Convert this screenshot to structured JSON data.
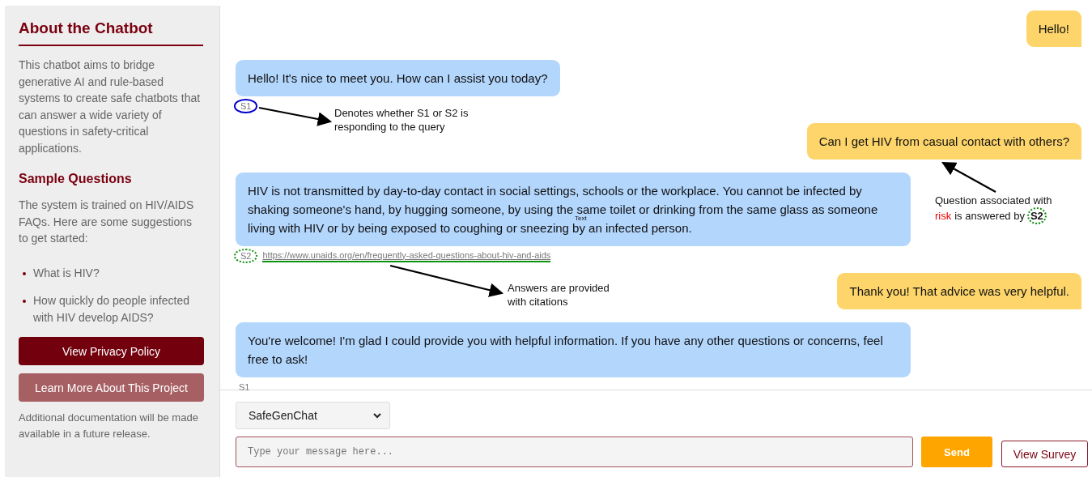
{
  "sidebar": {
    "title": "About the Chatbot",
    "intro": "This chatbot aims to bridge generative AI and rule-based systems to create safe chatbots that can answer a wide variety of questions in safety-critical applications.",
    "sample_title": "Sample Questions",
    "sample_intro": "The system is trained on HIV/AIDS FAQs. Here are some suggestions to get started:",
    "suggestions": [
      "What is HIV?",
      "How quickly do people infected with HIV develop AIDS?"
    ],
    "buttons": [
      {
        "label": "View Privacy Policy",
        "kind": "primary"
      },
      {
        "label": "Learn More About This Project",
        "kind": "secondary"
      }
    ],
    "footnote": "Additional documentation will be made available in a future release."
  },
  "messages": [
    {
      "kind": "user",
      "text": "Hello!"
    },
    {
      "kind": "bot",
      "text": "Hello! It's nice to meet you. How can I assist you today?",
      "source": "S1",
      "source_circle": {
        "kind": "solid",
        "color": "#0000cc"
      }
    },
    {
      "kind": "user",
      "text": "Can I get HIV from casual contact with others?"
    },
    {
      "kind": "bot",
      "text": "HIV is not transmitted by day-to-day contact in social settings, schools or the workplace. You cannot be infected by shaking someone's hand, by hugging someone, by using the same toilet or drinking from the same glass as someone living with HIV or by being exposed to coughing or sneezing by an infected person.",
      "source": "S2",
      "source_circle": {
        "kind": "dotted",
        "color": "#109010"
      },
      "citation": "https://www.unaids.org/en/frequently-asked-questions-about-hiv-and-aids",
      "citation_highlight": true
    },
    {
      "kind": "user",
      "text": "Thank you! That advice was very helpful."
    },
    {
      "kind": "bot",
      "text": "You're welcome! I'm glad I could provide you with helpful information. If you have any other questions or concerns, feel free to ask!",
      "source": "S1"
    }
  ],
  "annotations": {
    "source_note": "Denotes whether S1 or S2 is responding to the query",
    "risk_note": {
      "line": "Question associated with",
      "risk_word": "risk",
      "rest": "is answered by",
      "badge": "S2"
    },
    "citation_note": "Answers are provided with citations",
    "stray_label": "Text"
  },
  "composer": {
    "model": "SafeGenChat",
    "placeholder": "Type your message here...",
    "send": "Send",
    "survey": "View Survey"
  }
}
